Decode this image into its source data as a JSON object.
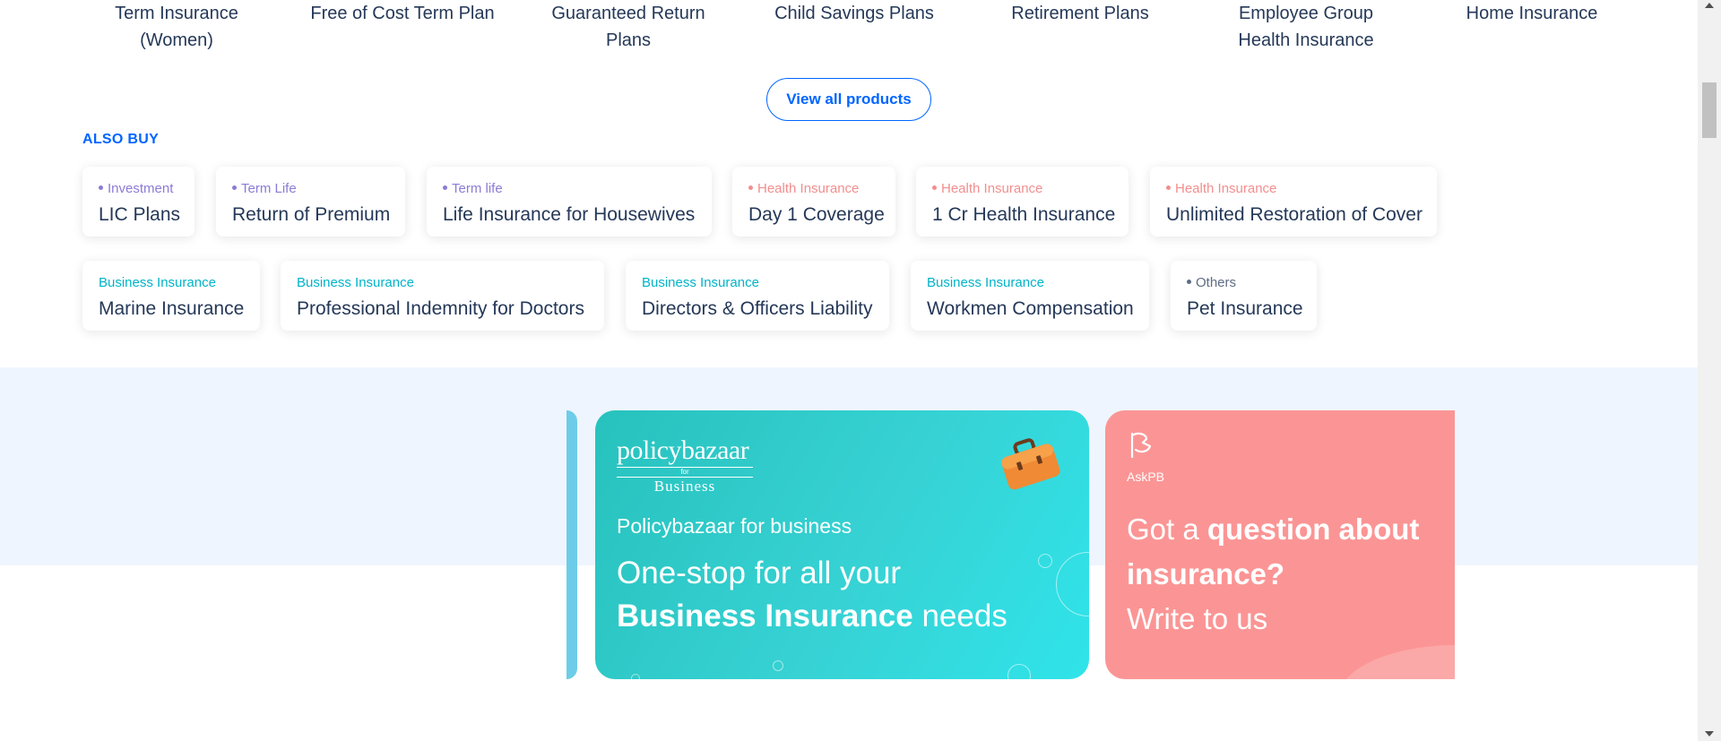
{
  "products": [
    "Term Insurance (Women)",
    "Free of Cost Term Plan",
    "Guaranteed Return Plans",
    "Child Savings Plans",
    "Retirement Plans",
    "Employee Group Health Insurance",
    "Home Insurance"
  ],
  "view_all_label": "View all products",
  "also_buy": {
    "heading": "ALSO BUY",
    "items": [
      {
        "tag": "Investment",
        "title": "LIC Plans",
        "color": "#8c7bd6",
        "dot": true
      },
      {
        "tag": "Term Life",
        "title": "Return of Premium",
        "color": "#8c7bd6",
        "dot": true
      },
      {
        "tag": "Term life",
        "title": "Life Insurance for Housewives",
        "color": "#8c7bd6",
        "dot": true
      },
      {
        "tag": "Health Insurance",
        "title": "Day 1 Coverage",
        "color": "#f38e8e",
        "dot": true
      },
      {
        "tag": "Health Insurance",
        "title": "1 Cr Health Insurance",
        "color": "#f38e8e",
        "dot": true
      },
      {
        "tag": "Health Insurance",
        "title": "Unlimited Restoration of Cover",
        "color": "#f38e8e",
        "dot": true
      },
      {
        "tag": "Business Insurance",
        "title": "Marine Insurance",
        "color": "#00b3c9",
        "dot": false
      },
      {
        "tag": "Business Insurance",
        "title": "Professional Indemnity for Doctors",
        "color": "#00b3c9",
        "dot": false
      },
      {
        "tag": "Business Insurance",
        "title": "Directors & Officers Liability",
        "color": "#00b3c9",
        "dot": false
      },
      {
        "tag": "Business Insurance",
        "title": "Workmen Compensation",
        "color": "#00b3c9",
        "dot": false
      },
      {
        "tag": "Others",
        "title": "Pet Insurance",
        "color": "#5e6c84",
        "dot": true
      }
    ]
  },
  "business_card": {
    "logo_main": "policybazaar",
    "logo_for": "for",
    "logo_business": "Business",
    "subtitle": "Policybazaar for business",
    "headline_pre": "One-stop for all your",
    "headline_bold": "Business Insurance",
    "headline_post": "needs",
    "bg_color": "#2cc9c6"
  },
  "ask_card": {
    "label": "AskPB",
    "headline_pre": "Got a",
    "headline_bold": "question about insurance?",
    "headline_post": "Write to us",
    "bg_color": "#fb9595"
  }
}
